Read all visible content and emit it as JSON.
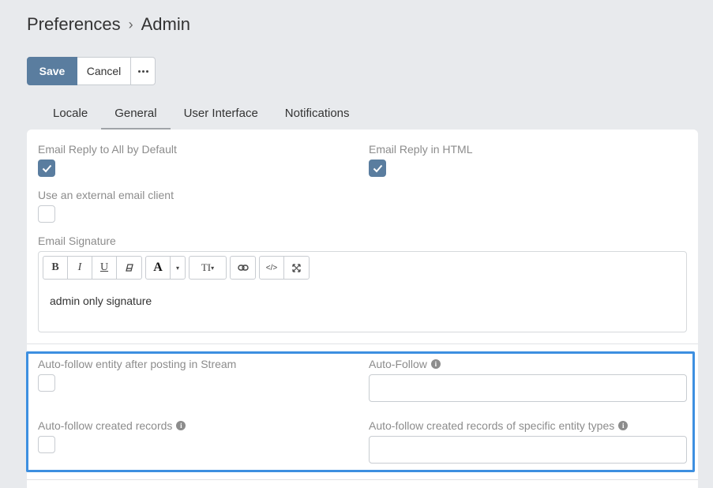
{
  "breadcrumb": {
    "parent": "Preferences",
    "current": "Admin"
  },
  "actions": {
    "save": "Save",
    "cancel": "Cancel"
  },
  "tabs": [
    {
      "label": "Locale"
    },
    {
      "label": "General",
      "active": true
    },
    {
      "label": "User Interface"
    },
    {
      "label": "Notifications"
    }
  ],
  "fields": {
    "email_reply_all": {
      "label": "Email Reply to All by Default",
      "checked": true
    },
    "email_reply_html": {
      "label": "Email Reply in HTML",
      "checked": true
    },
    "external_client": {
      "label": "Use an external email client",
      "checked": false
    },
    "signature": {
      "label": "Email Signature",
      "value": "admin only signature",
      "toolbar": {
        "bold": "B",
        "italic": "I",
        "underline": "U",
        "color": "A",
        "font_size": "TI",
        "code": "</>"
      }
    },
    "auto_follow_stream": {
      "label": "Auto-follow entity after posting in Stream",
      "checked": false
    },
    "auto_follow": {
      "label": "Auto-Follow",
      "value": ""
    },
    "auto_follow_created": {
      "label": "Auto-follow created records",
      "checked": false
    },
    "auto_follow_created_types": {
      "label": "Auto-follow created records of specific entity types",
      "value": ""
    }
  },
  "colors": {
    "accent": "#5a7d9f",
    "highlight": "#3d8fe0",
    "background": "#e8eaed"
  },
  "icons": {
    "check": "check-icon",
    "info": "info-icon",
    "more": "ellipsis-icon",
    "link": "link-icon",
    "fullscreen": "fullscreen-icon",
    "eraser": "eraser-icon"
  }
}
